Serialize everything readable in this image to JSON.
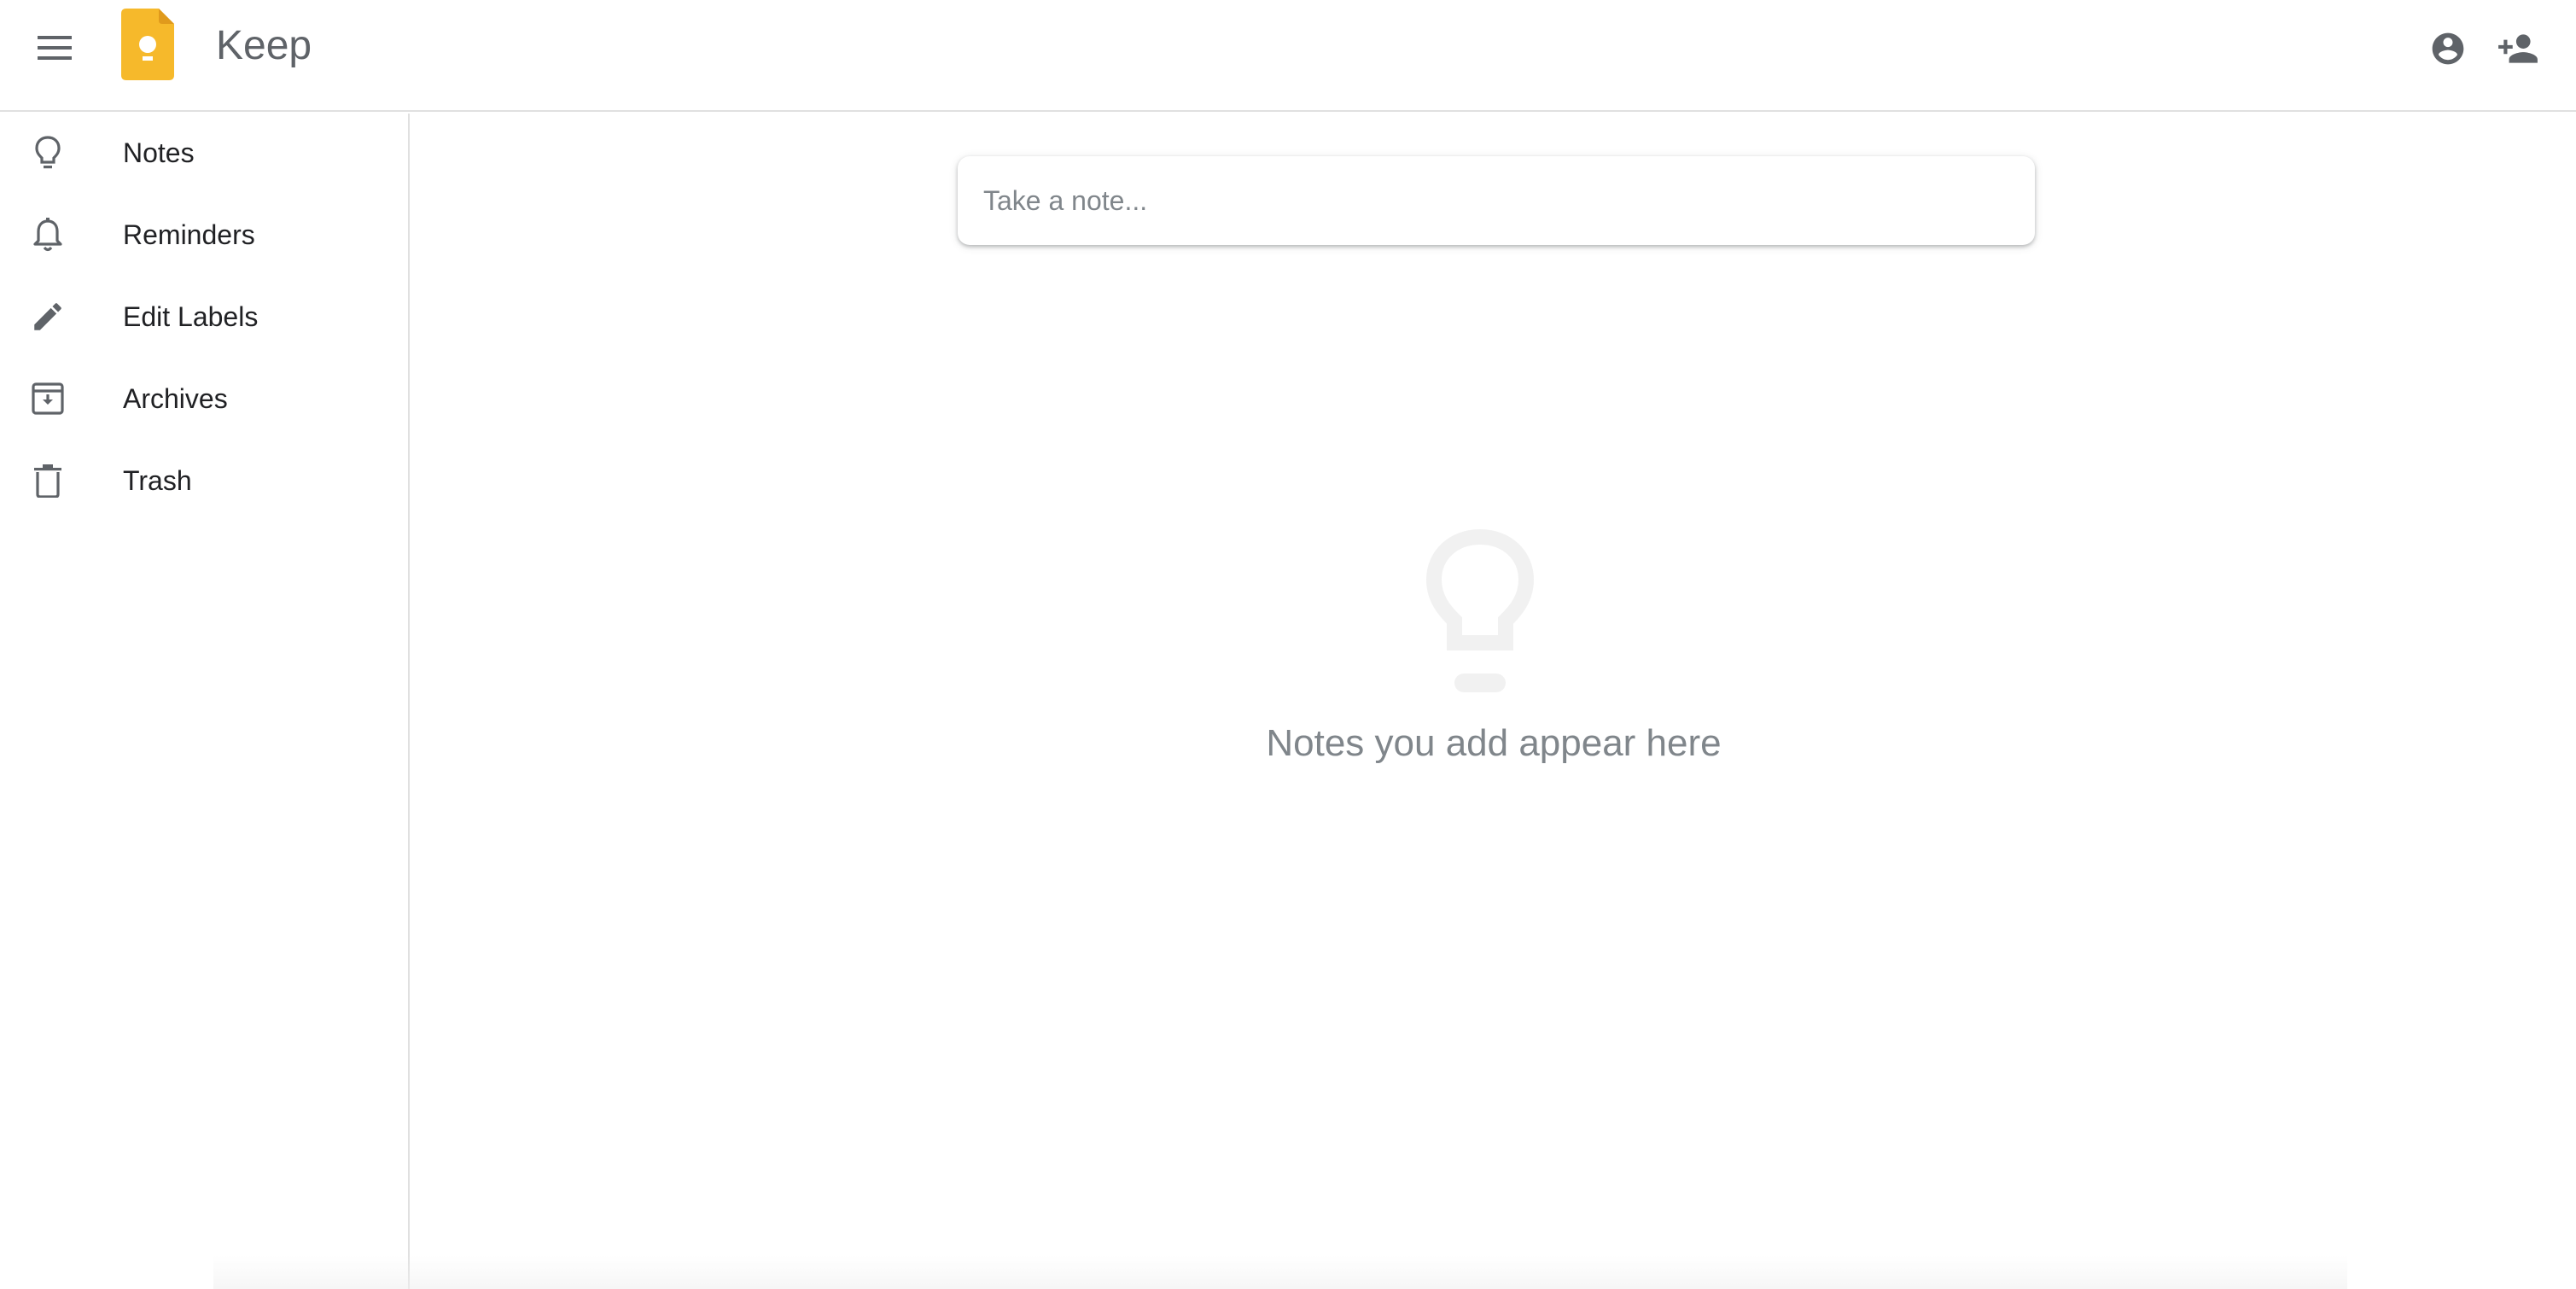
{
  "header": {
    "app_title": "Keep",
    "menu_icon": "menu-icon",
    "logo_icon": "keep-logo",
    "logo_color": "#f6b92b",
    "account_icon": "account-circle-icon",
    "add_user_icon": "person-add-icon"
  },
  "sidebar": {
    "items": [
      {
        "label": "Notes",
        "icon": "lightbulb-icon"
      },
      {
        "label": "Reminders",
        "icon": "bell-icon"
      },
      {
        "label": "Edit Labels",
        "icon": "pencil-icon"
      },
      {
        "label": "Archives",
        "icon": "archive-icon"
      },
      {
        "label": "Trash",
        "icon": "trash-icon"
      }
    ]
  },
  "main": {
    "note_input": {
      "placeholder": "Take a note...",
      "value": ""
    },
    "empty_state": {
      "icon": "lightbulb-icon",
      "text": "Notes you add appear here"
    }
  },
  "colors": {
    "icon_gray": "#5f6368",
    "text_gray": "#80868b",
    "divider": "#e0e0e0"
  }
}
